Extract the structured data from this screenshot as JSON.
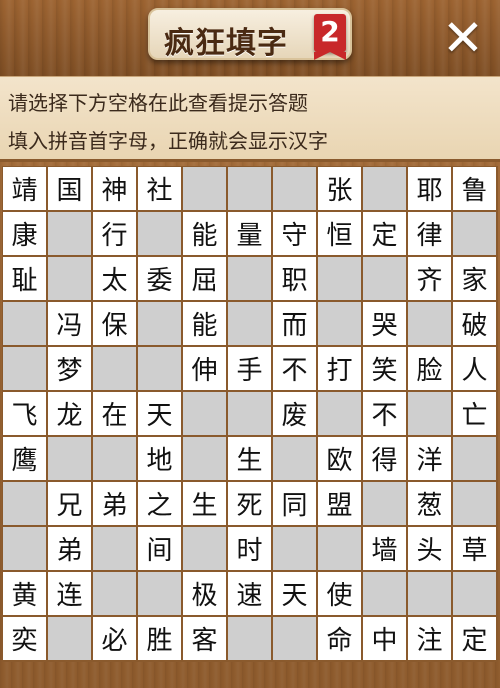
{
  "header": {
    "title": "疯狂填字",
    "badge": "2",
    "close_label": "✕"
  },
  "hints": {
    "line1": "请选择下方空格在此查看提示答题",
    "line2": "填入拼音首字母，正确就会显示汉字"
  },
  "grid": {
    "rows": [
      [
        "靖",
        "国",
        "神",
        "社",
        "#",
        "#",
        "#",
        "张",
        "#",
        "耶",
        "鲁"
      ],
      [
        "康",
        "#",
        "行",
        "#",
        "能",
        "量",
        "守",
        "恒",
        "定",
        "律",
        "#"
      ],
      [
        "耻",
        "#",
        "太",
        "委",
        "屈",
        "#",
        "职",
        "#",
        "#",
        "齐",
        "家"
      ],
      [
        "#",
        "冯",
        "保",
        "#",
        "能",
        "#",
        "而",
        "#",
        "哭",
        "#",
        "破"
      ],
      [
        "#",
        "梦",
        "#",
        "#",
        "伸",
        "手",
        "不",
        "打",
        "笑",
        "脸",
        "人"
      ],
      [
        "飞",
        "龙",
        "在",
        "天",
        "#",
        "#",
        "废",
        "#",
        "不",
        "#",
        "亡"
      ],
      [
        "鹰",
        "#",
        "#",
        "地",
        "#",
        "生",
        "#",
        "欧",
        "得",
        "洋",
        "#"
      ],
      [
        "#",
        "兄",
        "弟",
        "之",
        "生",
        "死",
        "同",
        "盟",
        "#",
        "葱",
        "#"
      ],
      [
        "#",
        "弟",
        "#",
        "间",
        "#",
        "时",
        "#",
        "#",
        "墙",
        "头",
        "草"
      ],
      [
        "黄",
        "连",
        "#",
        "#",
        "极",
        "速",
        "天",
        "使",
        "#",
        "#",
        "#"
      ],
      [
        "奕",
        "#",
        "必",
        "胜",
        "客",
        "#",
        "#",
        "命",
        "中",
        "注",
        "定"
      ]
    ],
    "blank_color": "#cfcfcf",
    "cell_color": "#ffffff"
  }
}
